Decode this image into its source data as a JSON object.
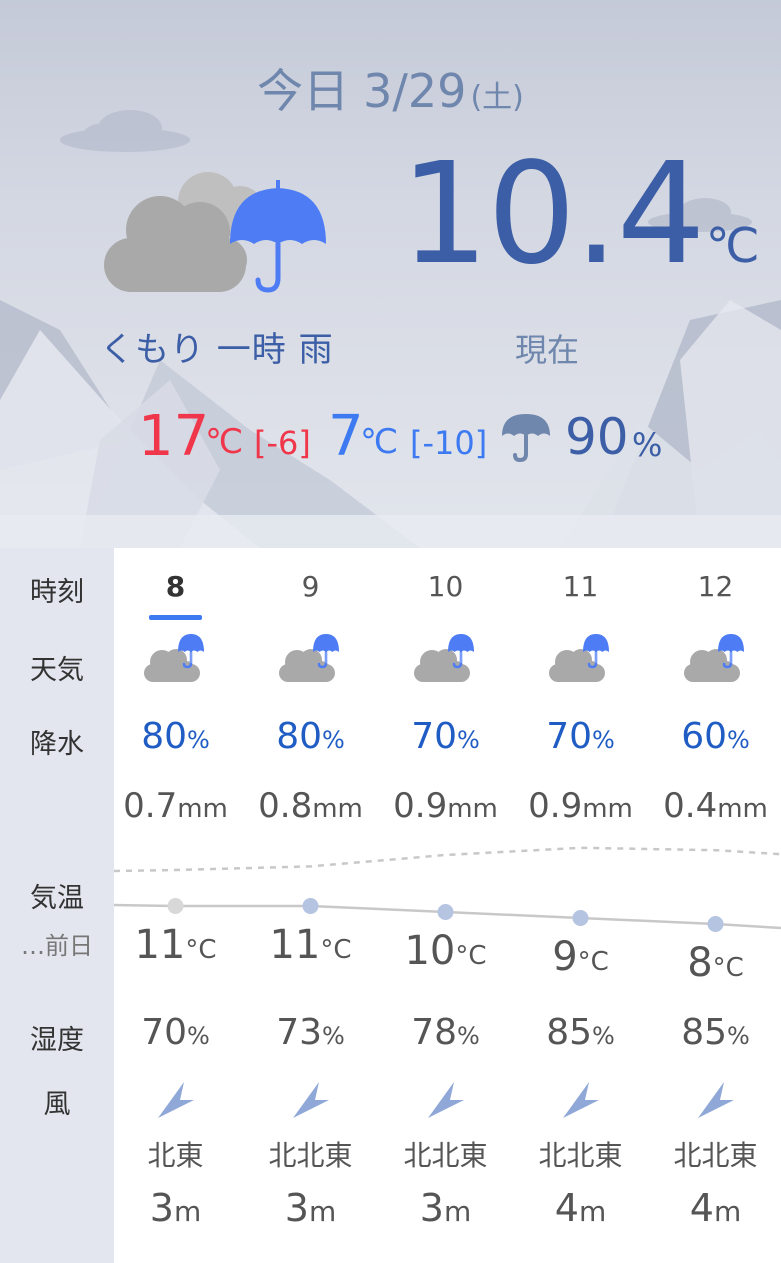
{
  "header": {
    "today_label": "今日",
    "date": "3/29",
    "day_of_week": "(土)",
    "condition": "くもり 一時 雨",
    "current_temp": "10.4",
    "current_temp_unit": "℃",
    "now_label": "現在",
    "high": "17",
    "high_unit": "℃",
    "high_diff": "[-6]",
    "low": "7",
    "low_unit": "℃",
    "low_diff": "[-10]",
    "rain_chance": "90",
    "rain_chance_unit": "%",
    "icon": "cloudy-with-rain-icon"
  },
  "row_labels": {
    "time": "時刻",
    "weather": "天気",
    "precip": "降水",
    "temp": "気温",
    "temp_sub": "…前日",
    "humidity": "湿度",
    "wind": "風"
  },
  "hours": [
    {
      "hour": "8",
      "icon": "cloudy-rain-icon",
      "pop": "80",
      "pop_unit": "%",
      "precip": "0.7",
      "precip_unit": "mm",
      "temp": "11",
      "temp_unit": "°C",
      "temp_value": 11,
      "prev_temp_value": 17,
      "humidity": "70",
      "humidity_unit": "%",
      "wind_dir": "北東",
      "wind_speed": "3",
      "wind_speed_unit": "m"
    },
    {
      "hour": "9",
      "icon": "cloudy-rain-icon",
      "pop": "80",
      "pop_unit": "%",
      "precip": "0.8",
      "precip_unit": "mm",
      "temp": "11",
      "temp_unit": "°C",
      "temp_value": 11,
      "prev_temp_value": 17.6,
      "humidity": "73",
      "humidity_unit": "%",
      "wind_dir": "北北東",
      "wind_speed": "3",
      "wind_speed_unit": "m"
    },
    {
      "hour": "10",
      "icon": "cloudy-rain-icon",
      "pop": "70",
      "pop_unit": "%",
      "precip": "0.9",
      "precip_unit": "mm",
      "temp": "10",
      "temp_unit": "°C",
      "temp_value": 10,
      "prev_temp_value": 19.5,
      "humidity": "78",
      "humidity_unit": "%",
      "wind_dir": "北北東",
      "wind_speed": "3",
      "wind_speed_unit": "m"
    },
    {
      "hour": "11",
      "icon": "cloudy-rain-icon",
      "pop": "70",
      "pop_unit": "%",
      "precip": "0.9",
      "precip_unit": "mm",
      "temp": "9",
      "temp_unit": "°C",
      "temp_value": 9,
      "prev_temp_value": 20.7,
      "humidity": "85",
      "humidity_unit": "%",
      "wind_dir": "北北東",
      "wind_speed": "4",
      "wind_speed_unit": "m"
    },
    {
      "hour": "12",
      "icon": "cloudy-rain-icon",
      "pop": "60",
      "pop_unit": "%",
      "precip": "0.4",
      "precip_unit": "mm",
      "temp": "8",
      "temp_unit": "°C",
      "temp_value": 8,
      "prev_temp_value": 20.3,
      "humidity": "85",
      "humidity_unit": "%",
      "wind_dir": "北北東",
      "wind_speed": "4",
      "wind_speed_unit": "m"
    }
  ],
  "current_hour_index": 0,
  "colors": {
    "accent_blue": "#3d7af2",
    "high_red": "#f0364a",
    "pop_blue": "#1f5cc4",
    "header_blue": "#3c5ea6",
    "cloud_gray": "#a9a9a9",
    "temp_dot": "#b5c4e0"
  }
}
